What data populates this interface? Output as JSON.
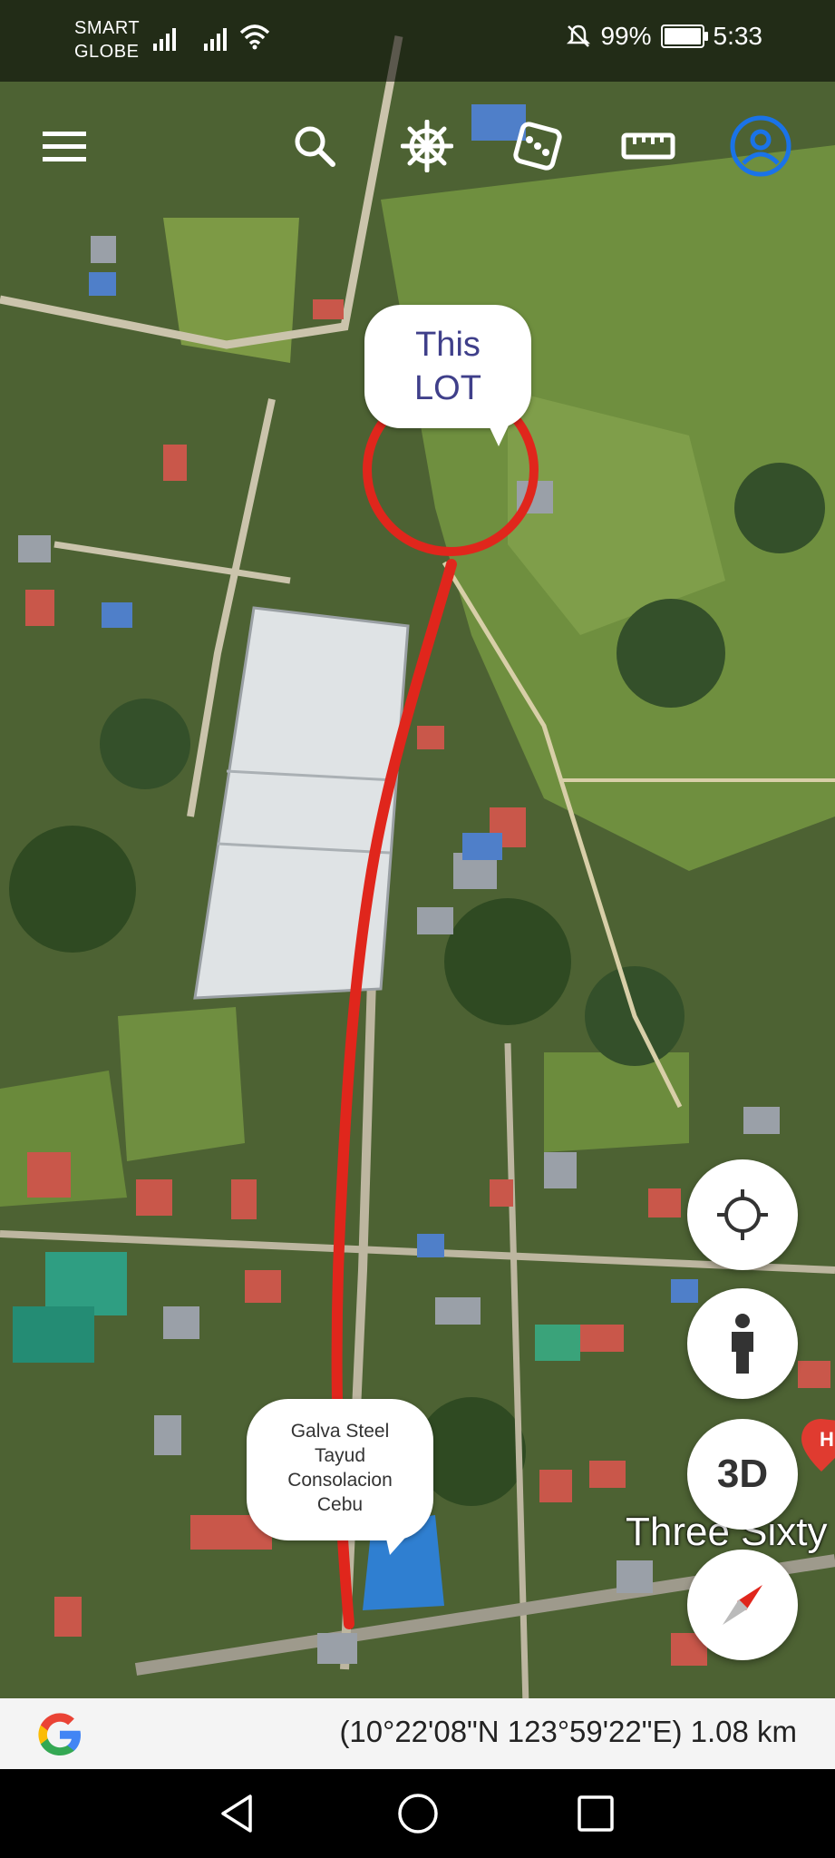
{
  "status_bar": {
    "carrier_line1": "SMART",
    "carrier_line2": "GLOBE",
    "battery": "99%",
    "time": "5:33"
  },
  "toolbar": {
    "items": [
      {
        "name": "menu-icon"
      },
      {
        "name": "search-icon"
      },
      {
        "name": "voyager-icon"
      },
      {
        "name": "dice-icon"
      },
      {
        "name": "ruler-icon"
      },
      {
        "name": "account-icon"
      }
    ],
    "accent": "#1a73e8"
  },
  "map": {
    "annotation_color": "#e0261c",
    "callout_lot": [
      "This",
      "LOT"
    ],
    "callout_galva": [
      "Galva Steel",
      "Tayud",
      "Consolacion",
      "Cebu"
    ],
    "place_label": "Three Sixty"
  },
  "controls": {
    "my_location": "crosshair-icon",
    "street_view": "pegman-icon",
    "three_d": "3D",
    "compass": "compass-icon"
  },
  "info_bar": {
    "coordinates": "(10°22'08\"N 123°59'22\"E) 1.08 km"
  },
  "nav_bar": {
    "items": [
      "back-icon",
      "home-icon",
      "recents-icon"
    ]
  }
}
